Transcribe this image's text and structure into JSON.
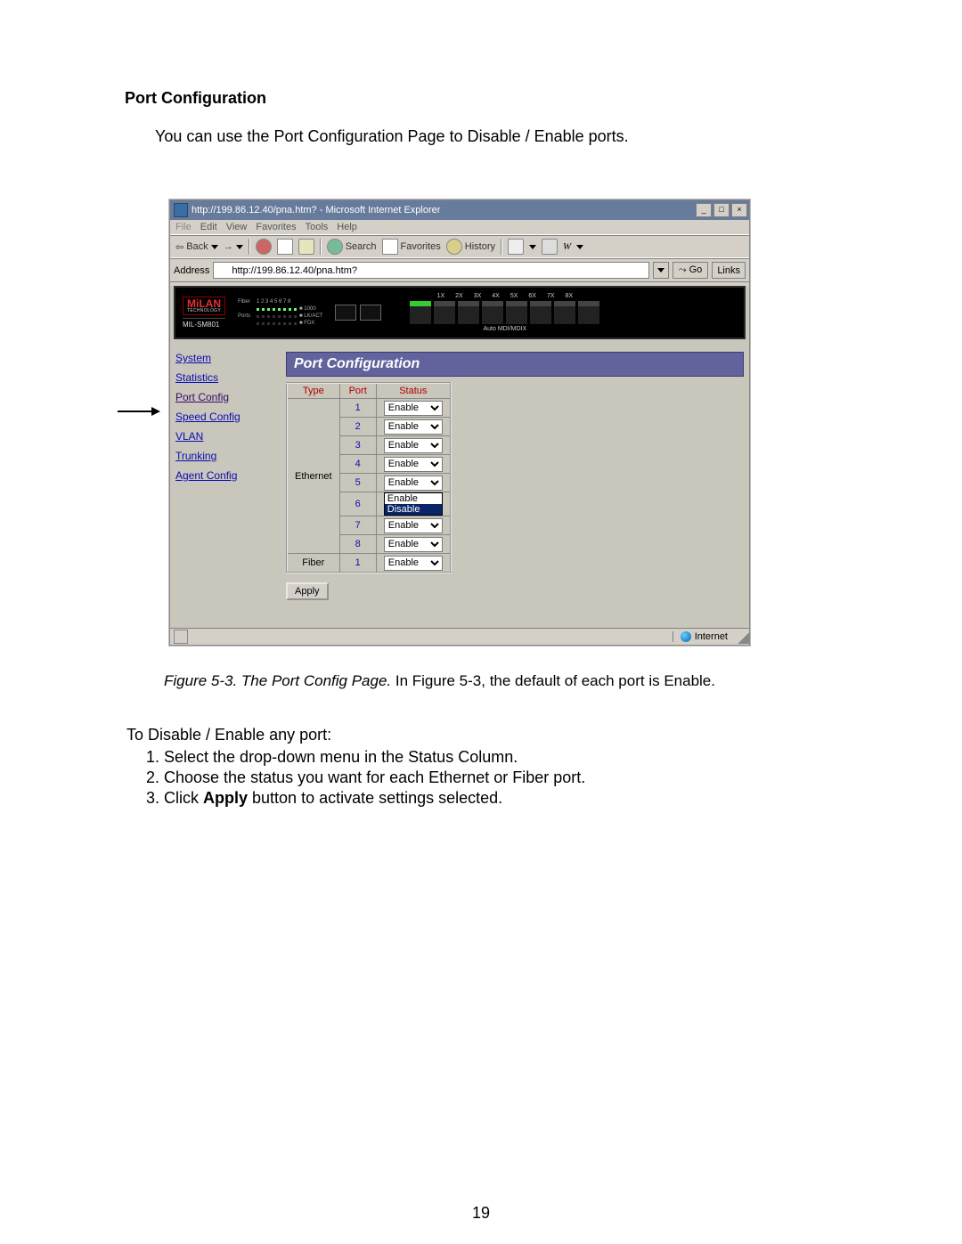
{
  "doc": {
    "heading": "Port Configuration",
    "intro": "You can use the Port Configuration Page to Disable / Enable ports.",
    "caption_italic": "Figure 5-3. The Port Config Page.",
    "caption_rest": "  In Figure 5-3, the default of each port is Enable.",
    "steps_intro": "To Disable / Enable any port:",
    "steps": {
      "s1": "Select the drop-down menu in the Status Column.",
      "s2": "Choose the status you want for each Ethernet or Fiber port.",
      "s3a": "Click ",
      "s3b": "Apply",
      "s3c": " button to activate settings selected."
    },
    "page_number": "19"
  },
  "ie": {
    "title": "http://199.86.12.40/pna.htm? - Microsoft Internet Explorer",
    "menu": {
      "file": "File",
      "edit": "Edit",
      "view": "View",
      "fav": "Favorites",
      "tools": "Tools",
      "help": "Help"
    },
    "toolbar": {
      "back": "Back",
      "search": "Search",
      "favorites": "Favorites",
      "history": "History"
    },
    "address_label": "Address",
    "address_value": "http://199.86.12.40/pna.htm?",
    "go": "Go",
    "links": "Links",
    "status_zone": "Internet"
  },
  "device": {
    "brand": "MiLAN",
    "brand_sub": "TECHNOLOGY",
    "model": "MIL-SM801",
    "port_labels": [
      "1X",
      "2X",
      "3X",
      "4X",
      "5X",
      "6X",
      "7X",
      "8X"
    ],
    "automdi": "Auto MDI/MDIX"
  },
  "nav": {
    "system": "System",
    "statistics": "Statistics",
    "portconfig": "Port Config",
    "speed": "Speed Config",
    "vlan": "VLAN",
    "trunking": "Trunking",
    "agent": "Agent Config"
  },
  "panel": {
    "title": "Port Configuration",
    "th_type": "Type",
    "th_port": "Port",
    "th_status": "Status",
    "type_eth": "Ethernet",
    "type_fiber": "Fiber",
    "ports": {
      "p1": "1",
      "p2": "2",
      "p3": "3",
      "p4": "4",
      "p5": "5",
      "p6": "6",
      "p7": "7",
      "p8": "8",
      "pf1": "1"
    },
    "opt_enable": "Enable",
    "opt_disable": "Disable",
    "apply": "Apply"
  }
}
